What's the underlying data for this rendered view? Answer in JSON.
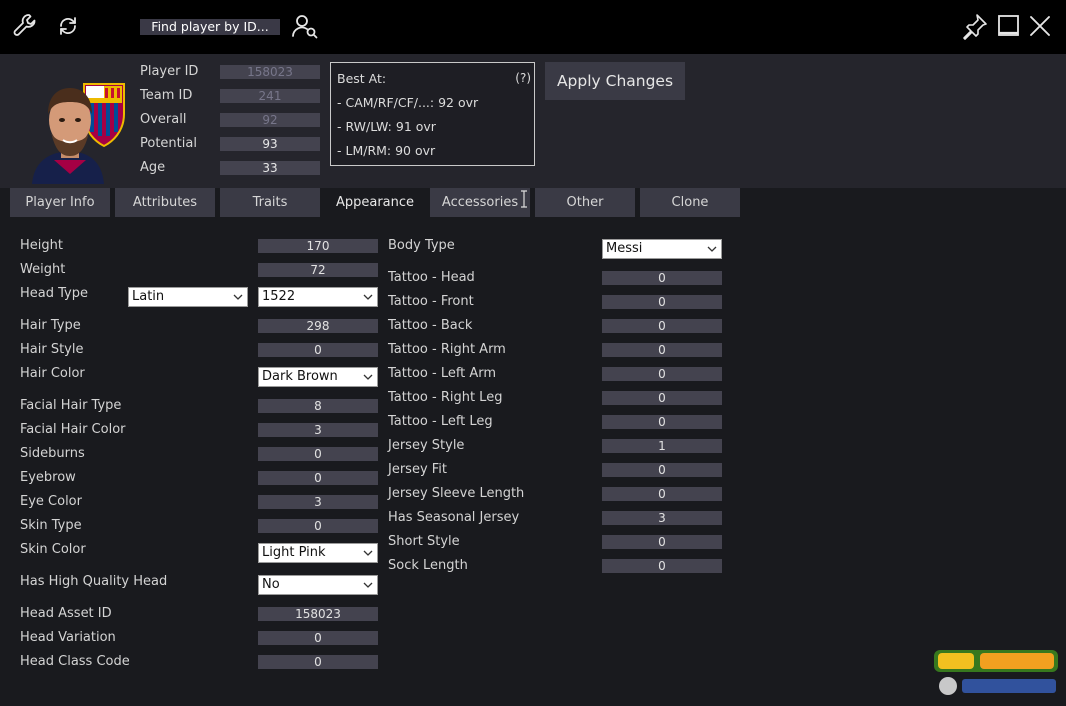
{
  "toolbar": {
    "find_label": "Find player by ID...",
    "icons": [
      "wrench-icon",
      "refresh-icon",
      "user-search-icon",
      "pin-icon",
      "minimize-icon",
      "close-icon"
    ]
  },
  "header": {
    "fields": [
      {
        "label": "Player ID",
        "value": "158023"
      },
      {
        "label": "Team ID",
        "value": "241"
      },
      {
        "label": "Overall",
        "value": "92"
      },
      {
        "label": "Potential",
        "value": "93"
      },
      {
        "label": "Age",
        "value": "33"
      }
    ],
    "best_at": {
      "title": "Best At:",
      "help": "(?)",
      "lines": [
        "- CAM/RF/CF/...: 92 ovr",
        "- RW/LW: 91 ovr",
        "- LM/RM: 90 ovr"
      ]
    },
    "apply_label": "Apply Changes"
  },
  "tabs": [
    "Player Info",
    "Attributes",
    "Traits",
    "Appearance",
    "Accessories",
    "Other",
    "Clone"
  ],
  "active_tab": "Appearance",
  "left": {
    "height": {
      "label": "Height",
      "value": "170"
    },
    "weight": {
      "label": "Weight",
      "value": "72"
    },
    "head_type": {
      "label": "Head Type",
      "select1": "Latin",
      "select2": "1522"
    },
    "hair_type": {
      "label": "Hair Type",
      "value": "298"
    },
    "hair_style": {
      "label": "Hair Style",
      "value": "0"
    },
    "hair_color": {
      "label": "Hair Color",
      "select": "Dark Brown"
    },
    "facial_hair_type": {
      "label": "Facial Hair Type",
      "value": "8"
    },
    "facial_hair_color": {
      "label": "Facial Hair Color",
      "value": "3"
    },
    "sideburns": {
      "label": "Sideburns",
      "value": "0"
    },
    "eyebrow": {
      "label": "Eyebrow",
      "value": "0"
    },
    "eye_color": {
      "label": "Eye Color",
      "value": "3"
    },
    "skin_type": {
      "label": "Skin Type",
      "value": "0"
    },
    "skin_color": {
      "label": "Skin Color",
      "select": "Light Pink"
    },
    "hq_head": {
      "label": "Has High Quality Head",
      "select": "No"
    },
    "head_asset_id": {
      "label": "Head Asset ID",
      "value": "158023"
    },
    "head_variation": {
      "label": "Head Variation",
      "value": "0"
    },
    "head_class_code": {
      "label": "Head Class Code",
      "value": "0"
    }
  },
  "right": {
    "body_type": {
      "label": "Body Type",
      "select": "Messi"
    },
    "tattoo_head": {
      "label": "Tattoo - Head",
      "value": "0"
    },
    "tattoo_front": {
      "label": "Tattoo - Front",
      "value": "0"
    },
    "tattoo_back": {
      "label": "Tattoo - Back",
      "value": "0"
    },
    "tattoo_right_arm": {
      "label": "Tattoo - Right Arm",
      "value": "0"
    },
    "tattoo_left_arm": {
      "label": "Tattoo - Left Arm",
      "value": "0"
    },
    "tattoo_right_leg": {
      "label": "Tattoo - Right Leg",
      "value": "0"
    },
    "tattoo_left_leg": {
      "label": "Tattoo - Left Leg",
      "value": "0"
    },
    "jersey_style": {
      "label": "Jersey Style",
      "value": "1"
    },
    "jersey_fit": {
      "label": "Jersey Fit",
      "value": "0"
    },
    "jersey_sleeve_length": {
      "label": "Jersey Sleeve Length",
      "value": "0"
    },
    "seasonal_jersey": {
      "label": "Has Seasonal Jersey",
      "value": "3"
    },
    "short_style": {
      "label": "Short Style",
      "value": "0"
    },
    "sock_length": {
      "label": "Sock Length",
      "value": "0"
    }
  },
  "colors": {
    "accent": "#3a3a45",
    "field": "#44434f",
    "background": "#191a1e"
  }
}
